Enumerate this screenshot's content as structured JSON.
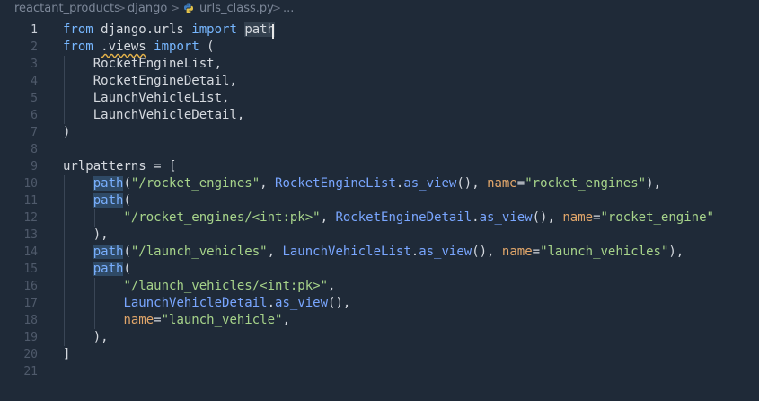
{
  "breadcrumb": {
    "items": [
      "reactant_products",
      "django",
      "urls_class.py",
      "..."
    ],
    "separator": ">"
  },
  "editor": {
    "language": "python",
    "current_line": 1,
    "line_numbers": [
      "1",
      "2",
      "3",
      "4",
      "5",
      "6",
      "7",
      "8",
      "9",
      "10",
      "11",
      "12",
      "13",
      "14",
      "15",
      "16",
      "17",
      "18",
      "19",
      "20",
      "21"
    ],
    "colors": {
      "background": "#1f2a38",
      "keyword": "#77b7ff",
      "string": "#a6d38a",
      "class": "#79a6ff",
      "kwarg": "#e1a66a",
      "text": "#d5d9df"
    },
    "lines": [
      [
        {
          "t": "from",
          "c": "kw"
        },
        {
          "t": " django.urls "
        },
        {
          "t": "import",
          "c": "kw"
        },
        {
          "t": " "
        },
        {
          "t": "path",
          "c": "hl-word"
        }
      ],
      [
        {
          "t": "from",
          "c": "kw"
        },
        {
          "t": " "
        },
        {
          "t": ".views",
          "c": "squiggle"
        },
        {
          "t": " "
        },
        {
          "t": "import",
          "c": "kw"
        },
        {
          "t": " ("
        }
      ],
      [
        {
          "t": "    RocketEngineList,"
        }
      ],
      [
        {
          "t": "    RocketEngineDetail,"
        }
      ],
      [
        {
          "t": "    LaunchVehicleList,"
        }
      ],
      [
        {
          "t": "    LaunchVehicleDetail,"
        }
      ],
      [
        {
          "t": ")"
        }
      ],
      [],
      [
        {
          "t": "urlpatterns = ["
        }
      ],
      [
        {
          "t": "    "
        },
        {
          "t": "path",
          "c": "pathfn"
        },
        {
          "t": "("
        },
        {
          "t": "\"/rocket_engines\"",
          "c": "str"
        },
        {
          "t": ", "
        },
        {
          "t": "RocketEngineList",
          "c": "cls"
        },
        {
          "t": "."
        },
        {
          "t": "as_view",
          "c": "cls"
        },
        {
          "t": "(), "
        },
        {
          "t": "name",
          "c": "kwarg"
        },
        {
          "t": "="
        },
        {
          "t": "\"rocket_engines\"",
          "c": "str"
        },
        {
          "t": "),"
        }
      ],
      [
        {
          "t": "    "
        },
        {
          "t": "path",
          "c": "pathfn"
        },
        {
          "t": "("
        }
      ],
      [
        {
          "t": "        "
        },
        {
          "t": "\"/rocket_engines/<int:pk>\"",
          "c": "str"
        },
        {
          "t": ", "
        },
        {
          "t": "RocketEngineDetail",
          "c": "cls"
        },
        {
          "t": "."
        },
        {
          "t": "as_view",
          "c": "cls"
        },
        {
          "t": "(), "
        },
        {
          "t": "name",
          "c": "kwarg"
        },
        {
          "t": "="
        },
        {
          "t": "\"rocket_engine\"",
          "c": "str"
        }
      ],
      [
        {
          "t": "    ),"
        }
      ],
      [
        {
          "t": "    "
        },
        {
          "t": "path",
          "c": "pathfn"
        },
        {
          "t": "("
        },
        {
          "t": "\"/launch_vehicles\"",
          "c": "str"
        },
        {
          "t": ", "
        },
        {
          "t": "LaunchVehicleList",
          "c": "cls"
        },
        {
          "t": "."
        },
        {
          "t": "as_view",
          "c": "cls"
        },
        {
          "t": "(), "
        },
        {
          "t": "name",
          "c": "kwarg"
        },
        {
          "t": "="
        },
        {
          "t": "\"launch_vehicles\"",
          "c": "str"
        },
        {
          "t": "),"
        }
      ],
      [
        {
          "t": "    "
        },
        {
          "t": "path",
          "c": "pathfn"
        },
        {
          "t": "("
        }
      ],
      [
        {
          "t": "        "
        },
        {
          "t": "\"/launch_vehicles/<int:pk>\"",
          "c": "str"
        },
        {
          "t": ","
        }
      ],
      [
        {
          "t": "        "
        },
        {
          "t": "LaunchVehicleDetail",
          "c": "cls"
        },
        {
          "t": "."
        },
        {
          "t": "as_view",
          "c": "cls"
        },
        {
          "t": "(),"
        }
      ],
      [
        {
          "t": "        "
        },
        {
          "t": "name",
          "c": "kwarg"
        },
        {
          "t": "="
        },
        {
          "t": "\"launch_vehicle\"",
          "c": "str"
        },
        {
          "t": ","
        }
      ],
      [
        {
          "t": "    ),"
        }
      ],
      [
        {
          "t": "]"
        }
      ],
      []
    ]
  }
}
